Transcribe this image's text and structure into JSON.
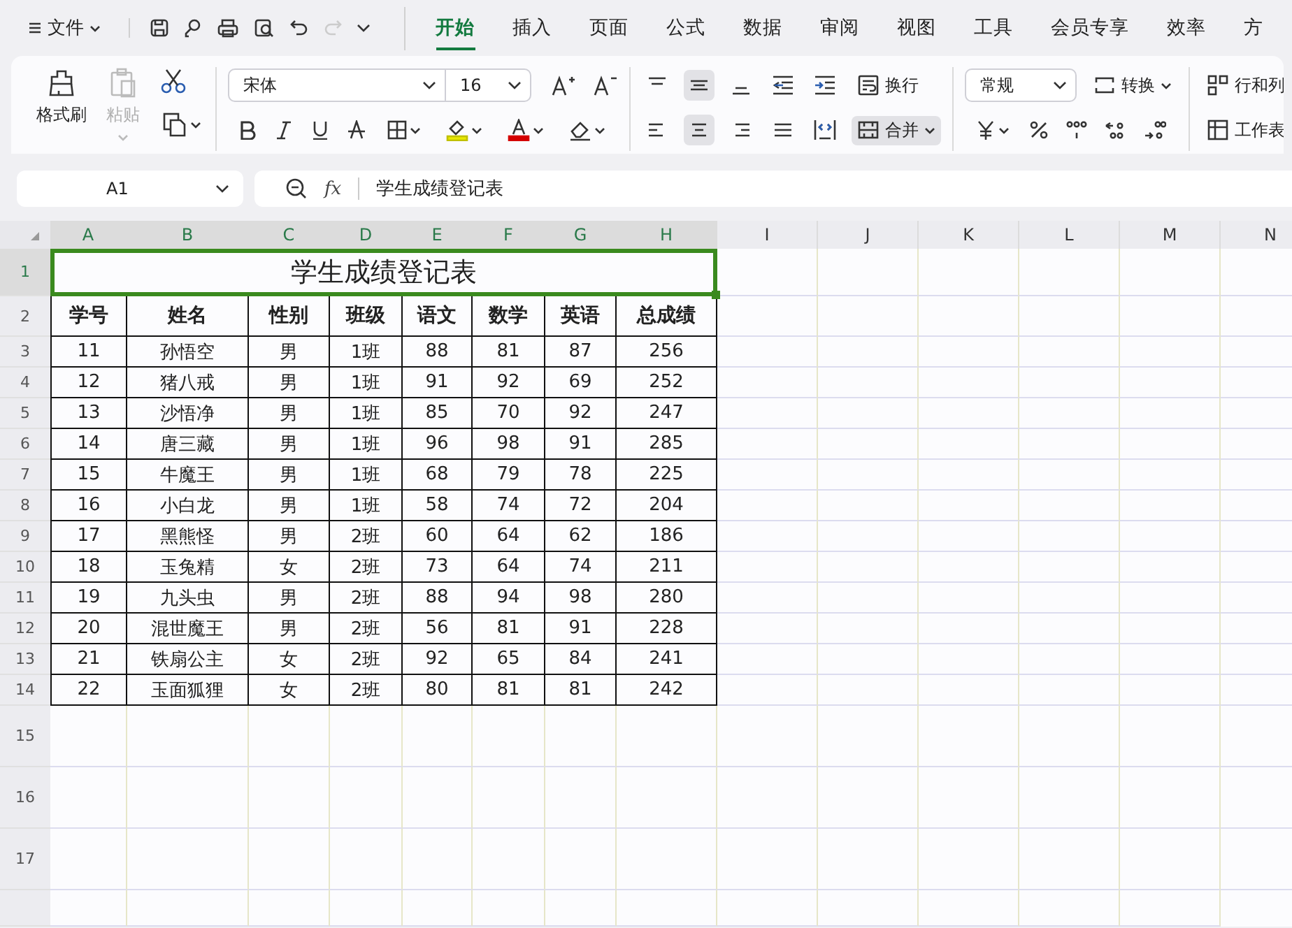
{
  "menu_bar": {
    "file_menu": "文件",
    "tabs": [
      {
        "label": "开始",
        "selected": true
      },
      {
        "label": "插入",
        "selected": false
      },
      {
        "label": "页面",
        "selected": false
      },
      {
        "label": "公式",
        "selected": false
      },
      {
        "label": "数据",
        "selected": false
      },
      {
        "label": "审阅",
        "selected": false
      },
      {
        "label": "视图",
        "selected": false
      },
      {
        "label": "工具",
        "selected": false
      },
      {
        "label": "会员专享",
        "selected": false
      },
      {
        "label": "效率",
        "selected": false
      },
      {
        "label": "方",
        "selected": false
      }
    ]
  },
  "ribbon": {
    "format_painter": "格式刷",
    "paste": {
      "label": "粘贴",
      "disabled": true
    },
    "font_name": "宋体",
    "font_size": "16",
    "wrap": "换行",
    "merge": {
      "label": "合并",
      "on": true
    },
    "number_format": "常规",
    "convert": "转换",
    "rows_columns": "行和列",
    "worksheet": "工作表"
  },
  "formula_bar": {
    "cell_ref": "A1",
    "function_label": "fx",
    "formula": "学生成绩登记表"
  },
  "sheet": {
    "columns": [
      {
        "label": "A",
        "selected": true
      },
      {
        "label": "B",
        "selected": true
      },
      {
        "label": "C",
        "selected": true
      },
      {
        "label": "D",
        "selected": true
      },
      {
        "label": "E",
        "selected": true
      },
      {
        "label": "F",
        "selected": true
      },
      {
        "label": "G",
        "selected": true
      },
      {
        "label": "H",
        "selected": true
      },
      {
        "label": "I",
        "selected": false
      },
      {
        "label": "J",
        "selected": false
      },
      {
        "label": "K",
        "selected": false
      },
      {
        "label": "L",
        "selected": false
      },
      {
        "label": "M",
        "selected": false
      },
      {
        "label": "N",
        "selected": false
      }
    ],
    "row_numbers": [
      {
        "label": "1",
        "selected": true
      },
      {
        "label": "2",
        "selected": false
      },
      {
        "label": "3",
        "selected": false
      },
      {
        "label": "4",
        "selected": false
      },
      {
        "label": "5",
        "selected": false
      },
      {
        "label": "6",
        "selected": false
      },
      {
        "label": "7",
        "selected": false
      },
      {
        "label": "8",
        "selected": false
      },
      {
        "label": "9",
        "selected": false
      },
      {
        "label": "10",
        "selected": false
      },
      {
        "label": "11",
        "selected": false
      },
      {
        "label": "12",
        "selected": false
      },
      {
        "label": "13",
        "selected": false
      },
      {
        "label": "14",
        "selected": false
      },
      {
        "label": "15",
        "selected": false
      },
      {
        "label": "16",
        "selected": false
      },
      {
        "label": "17",
        "selected": false
      }
    ],
    "title": {
      "text": "学生成绩登记表",
      "selected": true
    },
    "header": [
      "学号",
      "姓名",
      "性别",
      "班级",
      "语文",
      "数学",
      "英语",
      "总成绩"
    ],
    "rows": [
      [
        "11",
        "孙悟空",
        "男",
        "1班",
        "88",
        "81",
        "87",
        "256"
      ],
      [
        "12",
        "猪八戒",
        "男",
        "1班",
        "91",
        "92",
        "69",
        "252"
      ],
      [
        "13",
        "沙悟净",
        "男",
        "1班",
        "85",
        "70",
        "92",
        "247"
      ],
      [
        "14",
        "唐三藏",
        "男",
        "1班",
        "96",
        "98",
        "91",
        "285"
      ],
      [
        "15",
        "牛魔王",
        "男",
        "1班",
        "68",
        "79",
        "78",
        "225"
      ],
      [
        "16",
        "小白龙",
        "男",
        "1班",
        "58",
        "74",
        "72",
        "204"
      ],
      [
        "17",
        "黑熊怪",
        "男",
        "2班",
        "60",
        "64",
        "62",
        "186"
      ],
      [
        "18",
        "玉兔精",
        "女",
        "2班",
        "73",
        "64",
        "74",
        "211"
      ],
      [
        "19",
        "九头虫",
        "男",
        "2班",
        "88",
        "94",
        "98",
        "280"
      ],
      [
        "20",
        "混世魔王",
        "男",
        "2班",
        "56",
        "81",
        "91",
        "228"
      ],
      [
        "21",
        "铁扇公主",
        "女",
        "2班",
        "92",
        "65",
        "84",
        "241"
      ],
      [
        "22",
        "玉面狐狸",
        "女",
        "2班",
        "80",
        "81",
        "81",
        "242"
      ]
    ]
  }
}
